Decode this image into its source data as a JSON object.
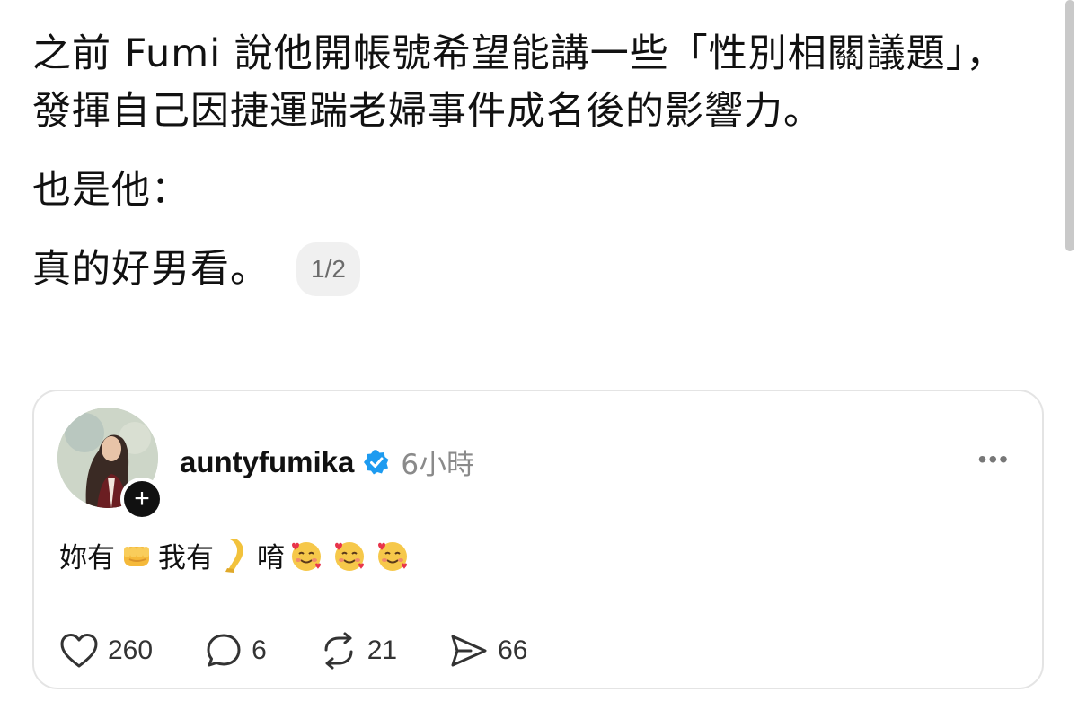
{
  "post": {
    "paragraphs": [
      "之前 Fumi 說他開帳號希望能講一些「性別相關議題」，發揮自己因捷運踹老婦事件成名後的影響力。",
      "也是他：",
      "真的好男看。"
    ],
    "page_indicator": "1/2"
  },
  "quoted_post": {
    "username": "auntyfumika",
    "verified_icon": "verified-badge-icon",
    "timestamp": "6小時",
    "more_icon": "more-horizontal-icon",
    "more_label": "•••",
    "follow_symbol": "+",
    "text_segments": [
      "妳有",
      "我有",
      "唷"
    ],
    "emojis": [
      "oncoming-fist-emoji",
      "leg-emoji",
      "smiling-face-with-hearts-emoji",
      "smiling-face-with-hearts-emoji",
      "smiling-face-with-hearts-emoji"
    ],
    "actions": [
      {
        "icon": "heart-icon",
        "count": "260"
      },
      {
        "icon": "comment-icon",
        "count": "6"
      },
      {
        "icon": "repost-icon",
        "count": "21"
      },
      {
        "icon": "share-icon",
        "count": "66"
      }
    ]
  },
  "colors": {
    "text": "#111111",
    "muted": "#8a8a8a",
    "verified_blue": "#1d9bf0",
    "card_border": "#e4e4e4"
  }
}
